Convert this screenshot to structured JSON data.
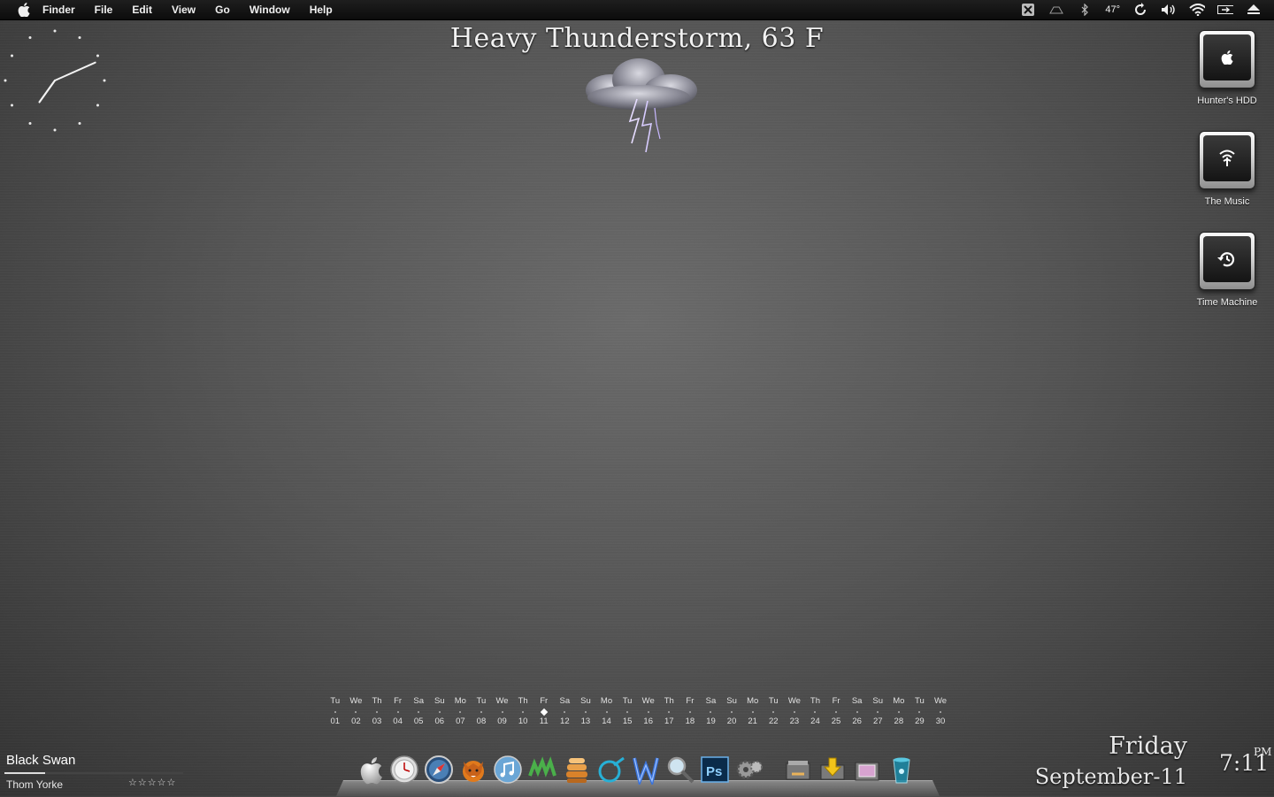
{
  "menubar": {
    "menus": [
      "Finder",
      "File",
      "Edit",
      "View",
      "Go",
      "Window",
      "Help"
    ],
    "temperature": "47°"
  },
  "weather": {
    "text": "Heavy Thunderstorm, 63 F",
    "icon": "thunderstorm-cloud-icon"
  },
  "drives": [
    {
      "label": "Hunter's HDD",
      "icon": "apple-logo-icon"
    },
    {
      "label": "The Music",
      "icon": "firewire-icon"
    },
    {
      "label": "Time Machine",
      "icon": "time-machine-icon"
    }
  ],
  "calendar": {
    "today_index": 10,
    "days": [
      {
        "dn": "Tu",
        "dd": "01"
      },
      {
        "dn": "We",
        "dd": "02"
      },
      {
        "dn": "Th",
        "dd": "03"
      },
      {
        "dn": "Fr",
        "dd": "04"
      },
      {
        "dn": "Sa",
        "dd": "05"
      },
      {
        "dn": "Su",
        "dd": "06"
      },
      {
        "dn": "Mo",
        "dd": "07"
      },
      {
        "dn": "Tu",
        "dd": "08"
      },
      {
        "dn": "We",
        "dd": "09"
      },
      {
        "dn": "Th",
        "dd": "10"
      },
      {
        "dn": "Fr",
        "dd": "11"
      },
      {
        "dn": "Sa",
        "dd": "12"
      },
      {
        "dn": "Su",
        "dd": "13"
      },
      {
        "dn": "Mo",
        "dd": "14"
      },
      {
        "dn": "Tu",
        "dd": "15"
      },
      {
        "dn": "We",
        "dd": "16"
      },
      {
        "dn": "Th",
        "dd": "17"
      },
      {
        "dn": "Fr",
        "dd": "18"
      },
      {
        "dn": "Sa",
        "dd": "19"
      },
      {
        "dn": "Su",
        "dd": "20"
      },
      {
        "dn": "Mo",
        "dd": "21"
      },
      {
        "dn": "Tu",
        "dd": "22"
      },
      {
        "dn": "We",
        "dd": "23"
      },
      {
        "dn": "Th",
        "dd": "24"
      },
      {
        "dn": "Fr",
        "dd": "25"
      },
      {
        "dn": "Sa",
        "dd": "26"
      },
      {
        "dn": "Su",
        "dd": "27"
      },
      {
        "dn": "Mo",
        "dd": "28"
      },
      {
        "dn": "Tu",
        "dd": "29"
      },
      {
        "dn": "We",
        "dd": "30"
      }
    ]
  },
  "now_playing": {
    "title": "Black Swan",
    "artist": "Thom Yorke",
    "rating": "☆☆☆☆☆",
    "progress": 0.23
  },
  "clock": {
    "day": "Friday",
    "date": "September-11",
    "time": "7:11",
    "ampm": "PM",
    "hour": 7,
    "minute": 11
  },
  "dock": {
    "apps": [
      "finder-icon",
      "clock-icon",
      "safari-icon",
      "firefox-icon",
      "itunes-icon",
      "dreamweaver-icon",
      "stacks-icon",
      "sharepoint-icon",
      "textwrangler-icon",
      "preview-icon",
      "photoshop-icon",
      "system-preferences-icon"
    ],
    "stacks": [
      "documents-stack-icon",
      "downloads-stack-icon",
      "pictures-stack-icon",
      "trash-icon"
    ]
  }
}
